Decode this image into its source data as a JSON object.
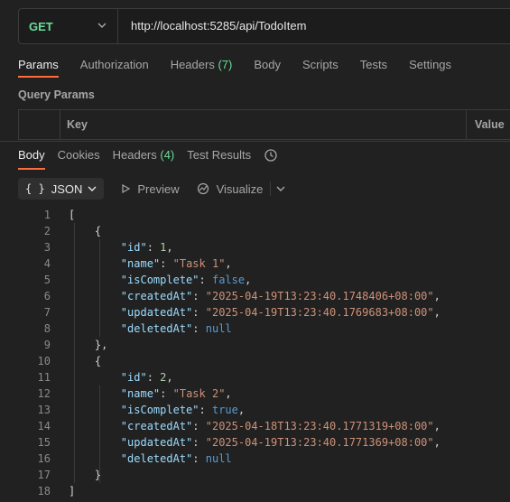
{
  "request": {
    "method": "GET",
    "url": "http://localhost:5285/api/TodoItem"
  },
  "request_tabs": [
    {
      "label": "Params",
      "count": ""
    },
    {
      "label": "Authorization",
      "count": ""
    },
    {
      "label": "Headers",
      "count": "(7)"
    },
    {
      "label": "Body",
      "count": ""
    },
    {
      "label": "Scripts",
      "count": ""
    },
    {
      "label": "Tests",
      "count": ""
    },
    {
      "label": "Settings",
      "count": ""
    }
  ],
  "query_params": {
    "title": "Query Params",
    "key_header": "Key",
    "value_header": "Value"
  },
  "response_tabs": [
    {
      "label": "Body",
      "count": ""
    },
    {
      "label": "Cookies",
      "count": ""
    },
    {
      "label": "Headers",
      "count": "(4)"
    },
    {
      "label": "Test Results",
      "count": ""
    }
  ],
  "toolbar": {
    "format_braces": "{ }",
    "format": "JSON",
    "preview": "Preview",
    "visualize": "Visualize"
  },
  "code_lines": [
    {
      "n": "1",
      "text": "["
    },
    {
      "n": "2",
      "text": "    {"
    },
    {
      "n": "3",
      "text": "        \"id\": 1,"
    },
    {
      "n": "4",
      "text": "        \"name\": \"Task 1\","
    },
    {
      "n": "5",
      "text": "        \"isComplete\": false,"
    },
    {
      "n": "6",
      "text": "        \"createdAt\": \"2025-04-19T13:23:40.1748406+08:00\","
    },
    {
      "n": "7",
      "text": "        \"updatedAt\": \"2025-04-19T13:23:40.1769683+08:00\","
    },
    {
      "n": "8",
      "text": "        \"deletedAt\": null"
    },
    {
      "n": "9",
      "text": "    },"
    },
    {
      "n": "10",
      "text": "    {"
    },
    {
      "n": "11",
      "text": "        \"id\": 2,"
    },
    {
      "n": "12",
      "text": "        \"name\": \"Task 2\","
    },
    {
      "n": "13",
      "text": "        \"isComplete\": true,"
    },
    {
      "n": "14",
      "text": "        \"createdAt\": \"2025-04-18T13:23:40.1771319+08:00\","
    },
    {
      "n": "15",
      "text": "        \"updatedAt\": \"2025-04-19T13:23:40.1771369+08:00\","
    },
    {
      "n": "16",
      "text": "        \"deletedAt\": null"
    },
    {
      "n": "17",
      "text": "    }"
    },
    {
      "n": "18",
      "text": "]"
    }
  ],
  "colors": {
    "accent": "#ff6c37",
    "method_green": "#6bdd9a",
    "json_key": "#9cdcfe",
    "json_string": "#ce9178",
    "json_number": "#b5cea8",
    "json_boolean": "#569cd6"
  },
  "icons": {
    "method_dropdown": "chevron-down-icon",
    "history": "history-icon",
    "preview": "play-icon",
    "visualize": "visualize-icon"
  }
}
